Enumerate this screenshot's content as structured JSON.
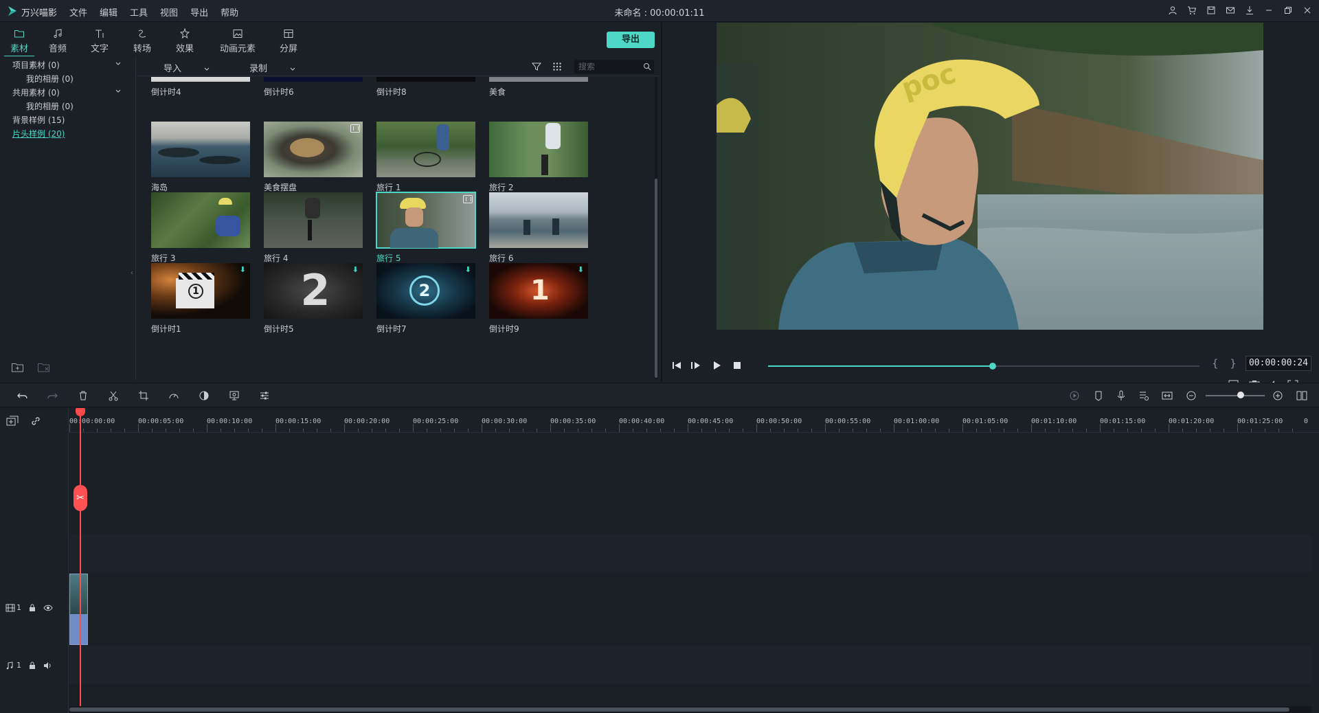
{
  "app": {
    "name": "万兴喵影",
    "window_title": "未命名 : 00:00:01:11",
    "menu": [
      "文件",
      "编辑",
      "工具",
      "视图",
      "导出",
      "帮助"
    ]
  },
  "title_icons": [
    "user-icon",
    "cart-icon",
    "save-icon",
    "mail-icon",
    "download-icon",
    "minimize-icon",
    "restore-icon",
    "close-icon"
  ],
  "tabs": [
    {
      "label": "素材",
      "icon": "folder-icon",
      "active": true
    },
    {
      "label": "音频",
      "icon": "music-note-icon"
    },
    {
      "label": "文字",
      "icon": "text-icon"
    },
    {
      "label": "转场",
      "icon": "transition-icon"
    },
    {
      "label": "效果",
      "icon": "effects-icon"
    },
    {
      "label": "动画元素",
      "icon": "image-icon"
    },
    {
      "label": "分屏",
      "icon": "split-screen-icon"
    }
  ],
  "export_label": "导出",
  "tree": [
    {
      "label": "项目素材 (0)",
      "expandable": true
    },
    {
      "label": "我的相册 (0)"
    },
    {
      "label": "共用素材 (0)",
      "expandable": true
    },
    {
      "label": "我的相册 (0)"
    },
    {
      "label": "背景样例 (15)"
    },
    {
      "label": "片头样例 (20)",
      "active": true
    }
  ],
  "media_toolbar": {
    "import_label": "导入",
    "record_label": "录制",
    "search_placeholder": "搜索"
  },
  "media": [
    {
      "label": "倒计时4"
    },
    {
      "label": "倒计时6"
    },
    {
      "label": "倒计时8"
    },
    {
      "label": "美食"
    },
    {
      "label": "海岛"
    },
    {
      "label": "美食摆盘",
      "badge": true
    },
    {
      "label": "旅行 1"
    },
    {
      "label": "旅行 2"
    },
    {
      "label": "旅行 3"
    },
    {
      "label": "旅行 4"
    },
    {
      "label": "旅行 5",
      "badge": true,
      "selected": true
    },
    {
      "label": "旅行 6"
    },
    {
      "label": "倒计时1",
      "download": true
    },
    {
      "label": "倒计时5",
      "download": true
    },
    {
      "label": "倒计时7",
      "download": true
    },
    {
      "label": "倒计时9",
      "download": true
    }
  ],
  "preview": {
    "timecode": "00:00:00:24",
    "progress": 0.52,
    "braces": "{ }"
  },
  "timeline": {
    "ruler_labels": [
      "00:00:00:00",
      "00:00:05:00",
      "00:00:10:00",
      "00:00:15:00",
      "00:00:20:00",
      "00:00:25:00",
      "00:00:30:00",
      "00:00:35:00",
      "00:00:40:00",
      "00:00:45:00",
      "00:00:50:00",
      "00:00:55:00",
      "00:01:00:00",
      "00:01:05:00",
      "00:01:10:00",
      "00:01:15:00",
      "00:01:20:00",
      "00:01:25:00"
    ],
    "ruler_tail": "0",
    "video_track": "1",
    "audio_track": "1",
    "zoom_level": 0.5
  },
  "colors": {
    "accent": "#4ed6c7",
    "playhead": "#ff4b4b"
  }
}
